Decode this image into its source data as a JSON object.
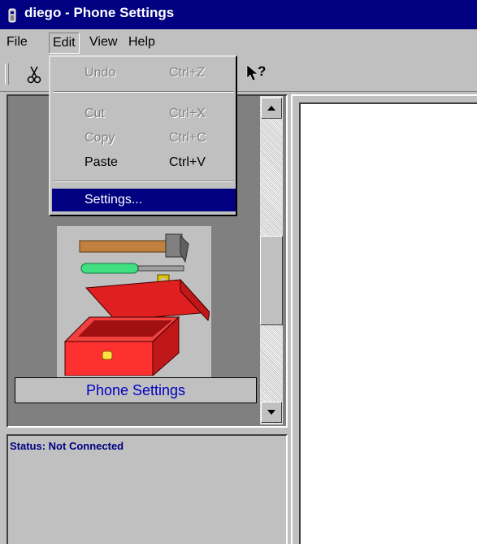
{
  "window": {
    "title": "diego - Phone Settings"
  },
  "menubar": {
    "file": "File",
    "edit": "Edit",
    "view": "View",
    "help": "Help"
  },
  "edit_menu": {
    "undo": {
      "label": "Undo",
      "shortcut": "Ctrl+Z"
    },
    "cut": {
      "label": "Cut",
      "shortcut": "Ctrl+X"
    },
    "copy": {
      "label": "Copy",
      "shortcut": "Ctrl+C"
    },
    "paste": {
      "label": "Paste",
      "shortcut": "Ctrl+V"
    },
    "settings": {
      "label": "Settings..."
    }
  },
  "toolbar": {
    "icons": [
      "scissors-icon",
      "help-pointer-icon"
    ],
    "help_glyph": "?"
  },
  "left_pane": {
    "tool_label": "Phone Settings",
    "tool_icon": "toolbox-icon"
  },
  "status": {
    "text": "Status: Not Connected"
  },
  "colors": {
    "title_bar": "#000080",
    "highlight": "#000080",
    "label_text": "#0000c0",
    "window_bg": "#c0c0c0"
  }
}
